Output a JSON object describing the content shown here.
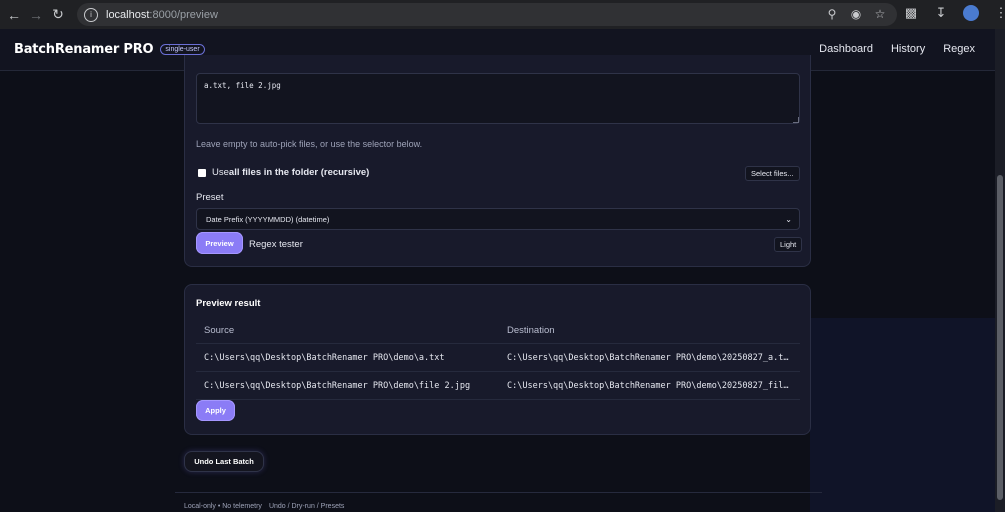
{
  "browser": {
    "url_host": "localhost",
    "url_rest": ":8000/preview"
  },
  "header": {
    "brand": "BatchRenamer PRO",
    "badge": "single-user",
    "nav": [
      "Dashboard",
      "History",
      "Regex"
    ]
  },
  "form": {
    "files_value": "a.txt, file 2.jpg",
    "hint": "Leave empty to auto-pick files, or use the selector below.",
    "use_all_prefix": "Use ",
    "use_all_bold": "all files in the folder (recursive)",
    "use_all_checked": false,
    "select_files_label": "Select files...",
    "preset_label": "Preset",
    "preset_value": "Date Prefix (YYYYMMDD) (datetime)",
    "preview_label": "Preview",
    "regex_tester_label": "Regex tester",
    "theme_toggle_label": "Light"
  },
  "preview": {
    "title": "Preview result",
    "columns": [
      "Source",
      "Destination"
    ],
    "rows": [
      {
        "source": "C:\\Users\\qq\\Desktop\\BatchRenamer PRO\\demo\\a.txt",
        "destination": "C:\\Users\\qq\\Desktop\\BatchRenamer PRO\\demo\\20250827_a.t…"
      },
      {
        "source": "C:\\Users\\qq\\Desktop\\BatchRenamer PRO\\demo\\file 2.jpg",
        "destination": "C:\\Users\\qq\\Desktop\\BatchRenamer PRO\\demo\\20250827_fil…"
      }
    ],
    "apply_label": "Apply"
  },
  "undo_label": "Undo Last Batch",
  "footer": {
    "left": "Local-only • No telemetry",
    "right": "Undo / Dry-run / Presets"
  },
  "colors": {
    "accent": "#8b7cf6",
    "background": "#0d0f18",
    "card": "#181a2b"
  }
}
